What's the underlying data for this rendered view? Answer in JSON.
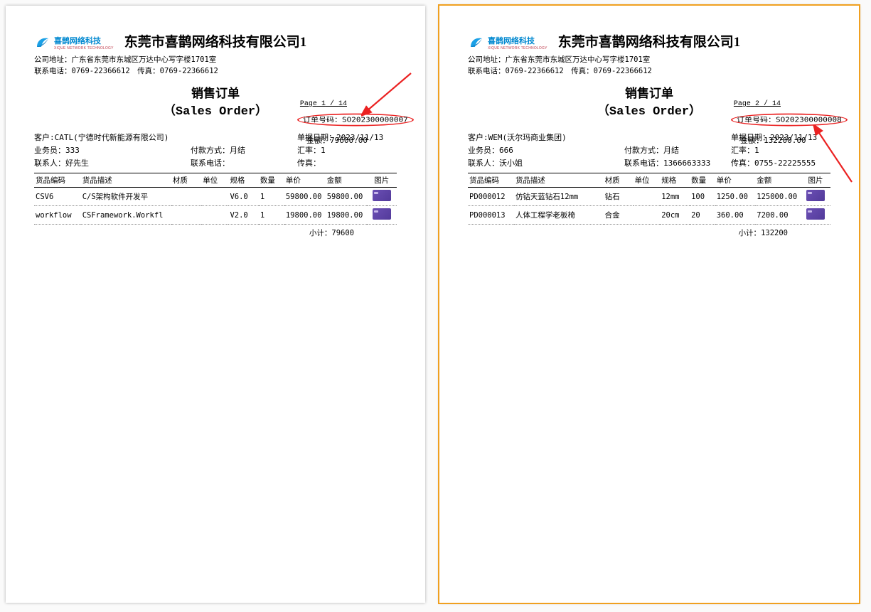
{
  "company": {
    "logo_text": "喜鹊网络科技",
    "logo_sub": "XIQUE NETWORK TECHNOLOGY",
    "title": "东莞市喜鹊网络科技有限公司1",
    "address": "公司地址：广东省东莞市东城区万达中心写字楼1701室",
    "phone_line": "联系电话：0769-22366612　传真：0769-22366612",
    "doc_title_cn": "销售订单",
    "doc_title_en": "（Sales Order）"
  },
  "labels": {
    "customer": "客户:",
    "salesman": "业务员：",
    "contact": "联系人：",
    "pay_method": "付款方式：",
    "contact_phone": "联系电话：",
    "doc_date": "单据日期：",
    "rate": "汇率：",
    "fax": "传真：",
    "order_no": "订单号码：",
    "amount": "金额：",
    "subtotal": "小计：",
    "page": "Page",
    "page_sep": " / ",
    "cols": {
      "code": "货品编码",
      "desc": "货品描述",
      "material": "材质",
      "unit": "单位",
      "spec": "规格",
      "qty": "数量",
      "price": "单价",
      "line_amt": "金额",
      "pic": "图片"
    }
  },
  "pages": [
    {
      "page_no": "1",
      "page_total": "14",
      "header": {
        "customer": "CATL(宁德时代新能源有限公司)",
        "salesman": "333",
        "contact": "好先生",
        "pay_method": "月结",
        "contact_phone": "",
        "doc_date": "2023/11/13",
        "rate": "1",
        "fax": "",
        "order_no": "SO202300000007",
        "amount": "79600.00"
      },
      "rows": [
        {
          "code": "CSV6",
          "desc": "C/S架构软件开发平",
          "material": "",
          "unit": "",
          "spec": "V6.0",
          "qty": "1",
          "price": "59800.00",
          "line_amt": "59800.00"
        },
        {
          "code": "workflow",
          "desc": "CSFramework.Workfl",
          "material": "",
          "unit": "",
          "spec": "V2.0",
          "qty": "1",
          "price": "19800.00",
          "line_amt": "19800.00"
        }
      ],
      "subtotal": "79600"
    },
    {
      "page_no": "2",
      "page_total": "14",
      "header": {
        "customer": "WEM(沃尔玛商业集团)",
        "salesman": "666",
        "contact": "沃小姐",
        "pay_method": "月结",
        "contact_phone": "1366663333",
        "doc_date": "2023/11/13",
        "rate": "1",
        "fax": "0755-22225555",
        "order_no": "SO202300000008",
        "amount": "132200.00"
      },
      "rows": [
        {
          "code": "PD000012",
          "desc": "仿钴天蓝钻石12mm",
          "material": "钻石",
          "unit": "",
          "spec": "12mm",
          "qty": "100",
          "price": "1250.00",
          "line_amt": "125000.00"
        },
        {
          "code": "PD000013",
          "desc": "人体工程学老板椅",
          "material": "合金",
          "unit": "",
          "spec": "20cm",
          "qty": "20",
          "price": "360.00",
          "line_amt": "7200.00"
        }
      ],
      "subtotal": "132200"
    }
  ]
}
